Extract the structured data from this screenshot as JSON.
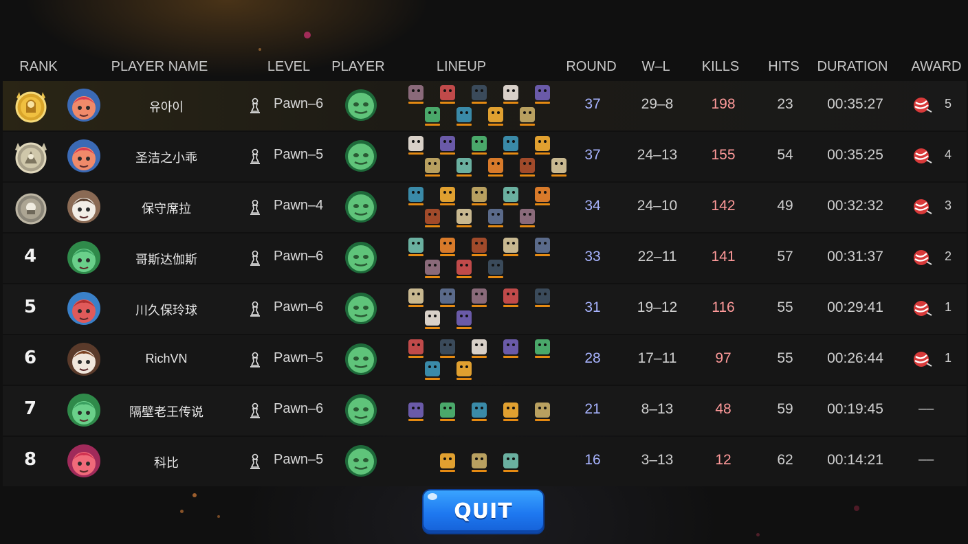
{
  "header": {
    "rank": "RANK",
    "player_name": "PLAYER NAME",
    "level": "LEVEL",
    "player": "PLAYER",
    "lineup": "LINEUP",
    "round": "ROUND",
    "wl": "W–L",
    "kills": "KILLS",
    "hits": "HITS",
    "duration": "DURATION",
    "award": "AWARD"
  },
  "rows": [
    {
      "rank": "1",
      "name": "유아이",
      "level": "Pawn–6",
      "round": "37",
      "wl": "29–8",
      "kills": "198",
      "hits": "23",
      "duration": "00:35:27",
      "award": "5"
    },
    {
      "rank": "2",
      "name": "圣洁之小乖",
      "level": "Pawn–5",
      "round": "37",
      "wl": "24–13",
      "kills": "155",
      "hits": "54",
      "duration": "00:35:25",
      "award": "4"
    },
    {
      "rank": "3",
      "name": "保守席拉",
      "level": "Pawn–4",
      "round": "34",
      "wl": "24–10",
      "kills": "142",
      "hits": "49",
      "duration": "00:32:32",
      "award": "3"
    },
    {
      "rank": "4",
      "name": "哥斯达伽斯",
      "level": "Pawn–6",
      "round": "33",
      "wl": "22–11",
      "kills": "141",
      "hits": "57",
      "duration": "00:31:37",
      "award": "2"
    },
    {
      "rank": "5",
      "name": "川久保玲球",
      "level": "Pawn–6",
      "round": "31",
      "wl": "19–12",
      "kills": "116",
      "hits": "55",
      "duration": "00:29:41",
      "award": "1"
    },
    {
      "rank": "6",
      "name": "RichVN",
      "level": "Pawn–5",
      "round": "28",
      "wl": "17–11",
      "kills": "97",
      "hits": "55",
      "duration": "00:26:44",
      "award": "1"
    },
    {
      "rank": "7",
      "name": "隔壁老王传说",
      "level": "Pawn–6",
      "round": "21",
      "wl": "8–13",
      "kills": "48",
      "hits": "59",
      "duration": "00:19:45",
      "award": "––"
    },
    {
      "rank": "8",
      "name": "科比",
      "level": "Pawn–5",
      "round": "16",
      "wl": "3–13",
      "kills": "12",
      "hits": "62",
      "duration": "00:14:21",
      "award": "––"
    }
  ],
  "icons": {
    "medal_gold": "gold-rank-medal-icon",
    "medal_silver": "silver-rank-medal-icon",
    "medal_bronze": "bronze-rank-medal-icon",
    "pawn": "pawn-chess-icon",
    "award": "candy-ball-icon"
  },
  "quit_label": "QUIT",
  "colors": {
    "round": "#a8b4ff",
    "kills": "#ff9a9a",
    "quit_button": "#1e78f0",
    "unit_stars": "#e58a12"
  }
}
